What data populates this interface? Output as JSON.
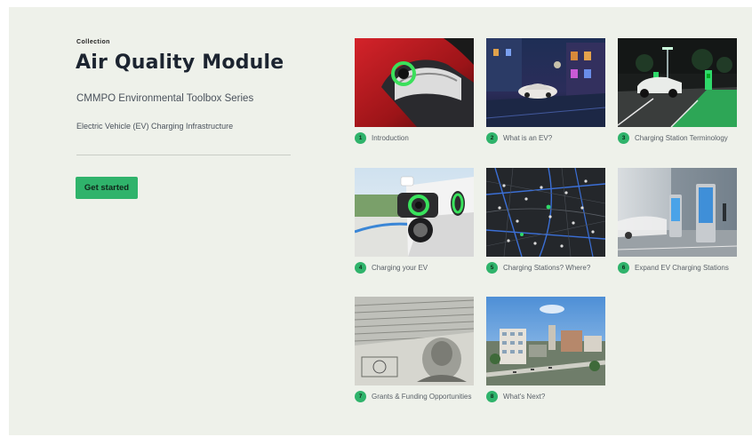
{
  "header": {
    "collection_label": "Collection",
    "title": "Air Quality Module",
    "subtitle": "CMMPO Environmental Toolbox Series",
    "description": "Electric Vehicle (EV) Charging Infrastructure",
    "start_button": "Get started"
  },
  "colors": {
    "accent": "#2fb36b",
    "background": "#eef1ea",
    "title": "#1c2430"
  },
  "cards": [
    {
      "number": "1",
      "label": "Introduction",
      "image": "ev-charger-plug-red-image"
    },
    {
      "number": "2",
      "label": "What is an EV?",
      "image": "ev-night-street-image"
    },
    {
      "number": "3",
      "label": "Charging Station Terminology",
      "image": "ev-charging-lot-night-image"
    },
    {
      "number": "4",
      "label": "Charging your EV",
      "image": "ev-charging-port-image"
    },
    {
      "number": "5",
      "label": "Charging Stations? Where?",
      "image": "charging-stations-map-image"
    },
    {
      "number": "6",
      "label": "Expand EV Charging Stations",
      "image": "ev-charging-kiosk-image"
    },
    {
      "number": "7",
      "label": "Grants & Funding Opportunities",
      "image": "dollar-bills-image"
    },
    {
      "number": "8",
      "label": "What's Next?",
      "image": "city-aerial-image"
    }
  ]
}
